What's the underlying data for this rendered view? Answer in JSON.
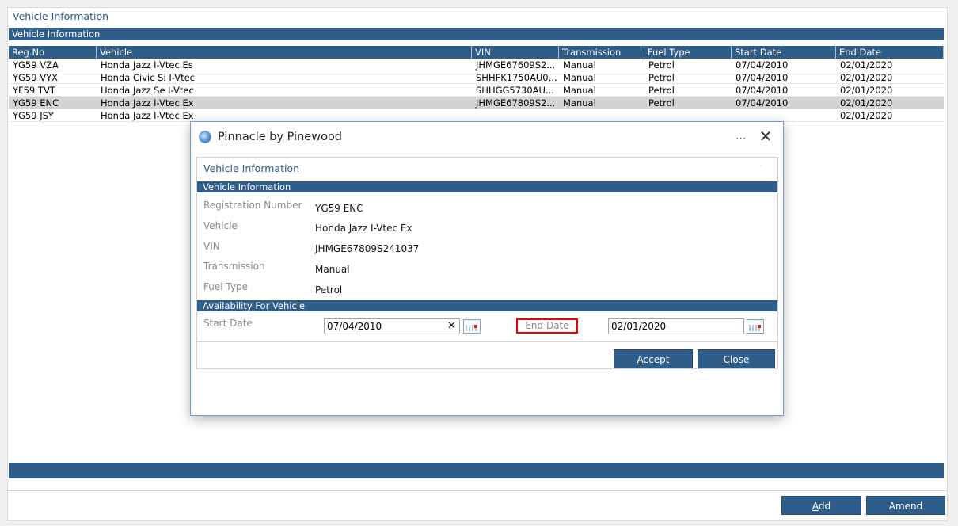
{
  "page": {
    "title": "Vehicle Information",
    "section_bar": "Vehicle Information"
  },
  "grid": {
    "columns": [
      "Reg.No",
      "Vehicle",
      "VIN",
      "Transmission",
      "Fuel Type",
      "Start Date",
      "End Date"
    ],
    "rows": [
      {
        "reg": "YG59 VZA",
        "vehicle": "Honda Jazz I-Vtec Es",
        "vin": "JHMGE67609S2...",
        "trans": "Manual",
        "fuel": "Petrol",
        "start": "07/04/2010",
        "end": "02/01/2020",
        "selected": false
      },
      {
        "reg": "YG59 VYX",
        "vehicle": "Honda Civic Si I-Vtec",
        "vin": "SHHFK1750AU0...",
        "trans": "Manual",
        "fuel": "Petrol",
        "start": "07/04/2010",
        "end": "02/01/2020",
        "selected": false
      },
      {
        "reg": "YF59 TVT",
        "vehicle": "Honda Jazz Se I-Vtec",
        "vin": "SHHGG5730AU...",
        "trans": "Manual",
        "fuel": "Petrol",
        "start": "07/04/2010",
        "end": "02/01/2020",
        "selected": false
      },
      {
        "reg": "YG59 ENC",
        "vehicle": "Honda Jazz I-Vtec Ex",
        "vin": "JHMGE67809S2...",
        "trans": "Manual",
        "fuel": "Petrol",
        "start": "07/04/2010",
        "end": "02/01/2020",
        "selected": true
      },
      {
        "reg": "YG59 JSY",
        "vehicle": "Honda Jazz I-Vtec Ex",
        "vin": "",
        "trans": "",
        "fuel": "",
        "start": "",
        "end": "02/01/2020",
        "selected": false
      }
    ]
  },
  "footer": {
    "add_label": "Add",
    "add_mnemonic": "A",
    "amend_label": "Amend"
  },
  "dialog": {
    "window_title": "Pinnacle by Pinewood",
    "more_glyph": "...",
    "close_glyph": "✕",
    "panel_title": "Vehicle Information",
    "section1": "Vehicle Information",
    "fields": [
      {
        "label": "Registration Number",
        "value": "YG59 ENC"
      },
      {
        "label": "Vehicle",
        "value": "Honda Jazz I-Vtec Ex"
      },
      {
        "label": "VIN",
        "value": "JHMGE67809S241037"
      },
      {
        "label": "Transmission",
        "value": "Manual"
      },
      {
        "label": "Fuel Type",
        "value": "Petrol"
      }
    ],
    "section2": "Availability For Vehicle",
    "start_date_label": "Start Date",
    "start_date_value": "07/04/2010",
    "end_date_label": "End Date",
    "end_date_value": "02/01/2020",
    "accept_label": "Accept",
    "close_label": "Close"
  },
  "icons": {
    "app": "pinnacle-app-icon",
    "calendar": "calendar-icon",
    "clear": "clear-x-icon"
  },
  "colors": {
    "brand_blue": "#2f5d8a",
    "title_blue": "#2c5a8c",
    "highlight_red": "#e00000",
    "selected_row": "#d4d4d4"
  }
}
